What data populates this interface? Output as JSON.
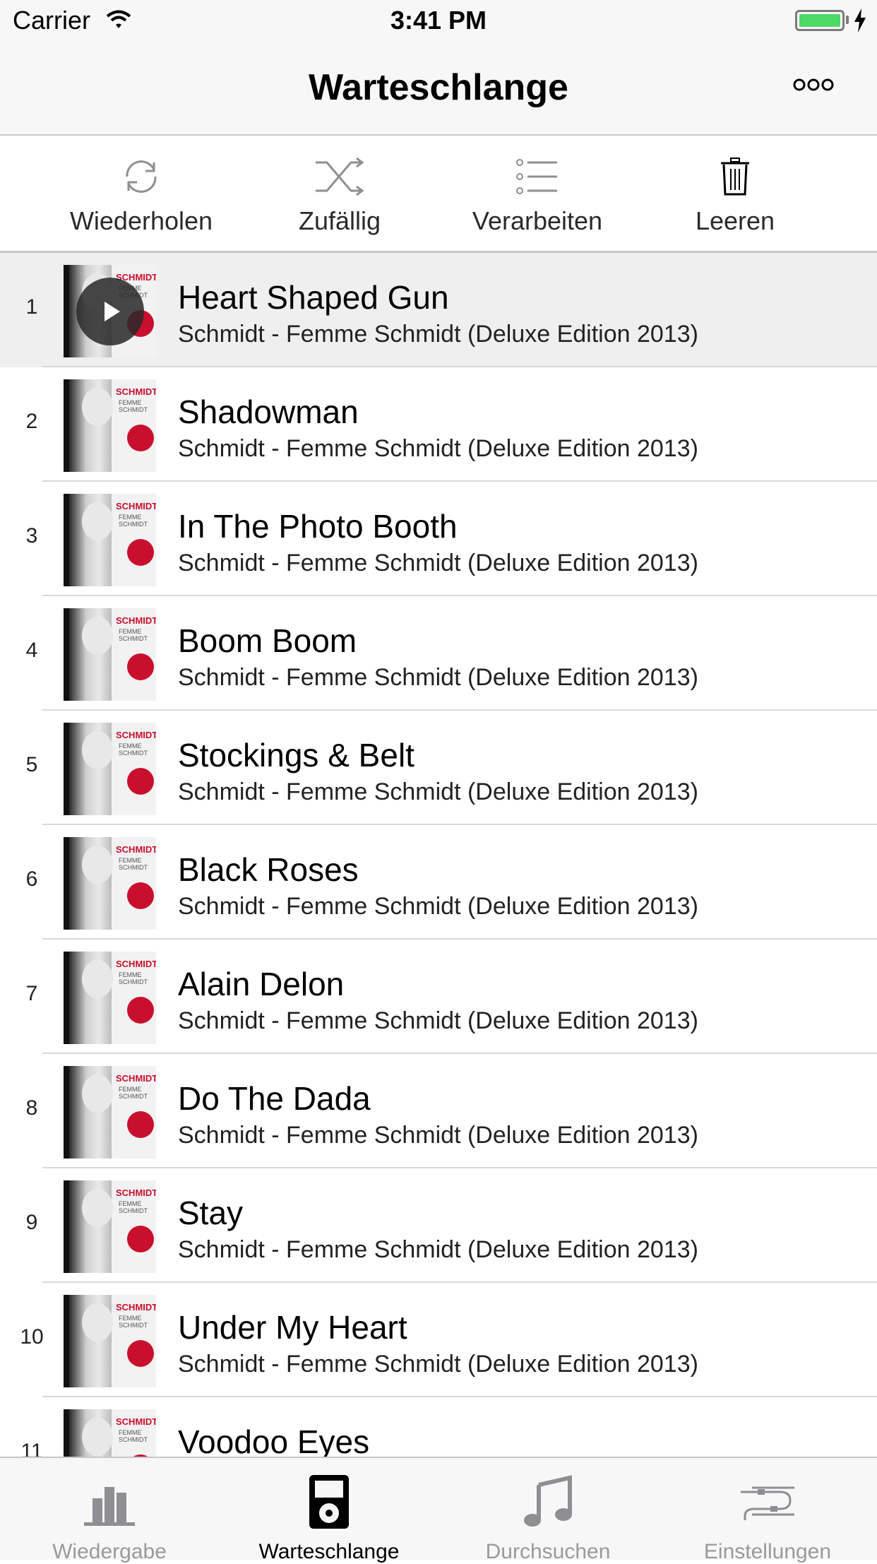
{
  "status_bar": {
    "carrier": "Carrier",
    "time": "3:41 PM"
  },
  "nav": {
    "title": "Warteschlange"
  },
  "toolbar": [
    {
      "label": "Wiederholen",
      "icon": "repeat-icon"
    },
    {
      "label": "Zufällig",
      "icon": "shuffle-icon"
    },
    {
      "label": "Verarbeiten",
      "icon": "list-edit-icon"
    },
    {
      "label": "Leeren",
      "icon": "trash-icon"
    }
  ],
  "album_art": {
    "brand": "SCHMIDT",
    "sub": "FEMME SCHMIDT"
  },
  "queue": [
    {
      "num": "1",
      "title": "Heart Shaped Gun",
      "subtitle": "Schmidt - Femme Schmidt (Deluxe Edition 2013)"
    },
    {
      "num": "2",
      "title": "Shadowman",
      "subtitle": "Schmidt - Femme Schmidt (Deluxe Edition 2013)"
    },
    {
      "num": "3",
      "title": "In The Photo Booth",
      "subtitle": "Schmidt - Femme Schmidt (Deluxe Edition 2013)"
    },
    {
      "num": "4",
      "title": "Boom Boom",
      "subtitle": "Schmidt - Femme Schmidt (Deluxe Edition 2013)"
    },
    {
      "num": "5",
      "title": "Stockings & Belt",
      "subtitle": "Schmidt - Femme Schmidt (Deluxe Edition 2013)"
    },
    {
      "num": "6",
      "title": "Black Roses",
      "subtitle": "Schmidt - Femme Schmidt (Deluxe Edition 2013)"
    },
    {
      "num": "7",
      "title": "Alain Delon",
      "subtitle": "Schmidt - Femme Schmidt (Deluxe Edition 2013)"
    },
    {
      "num": "8",
      "title": "Do The Dada",
      "subtitle": "Schmidt - Femme Schmidt (Deluxe Edition 2013)"
    },
    {
      "num": "9",
      "title": "Stay",
      "subtitle": "Schmidt - Femme Schmidt (Deluxe Edition 2013)"
    },
    {
      "num": "10",
      "title": "Under My Heart",
      "subtitle": "Schmidt - Femme Schmidt (Deluxe Edition 2013)"
    },
    {
      "num": "11",
      "title": "Voodoo Eyes",
      "subtitle": ""
    }
  ],
  "tabs": [
    {
      "label": "Wiedergabe",
      "icon": "bar-chart-icon"
    },
    {
      "label": "Warteschlange",
      "icon": "ipod-icon"
    },
    {
      "label": "Durchsuchen",
      "icon": "music-note-icon"
    },
    {
      "label": "Einstellungen",
      "icon": "cable-icon"
    }
  ],
  "colors": {
    "accent_battery": "#4cd964",
    "active_row": "#efefef",
    "tab_inactive": "#9a9a9a"
  }
}
